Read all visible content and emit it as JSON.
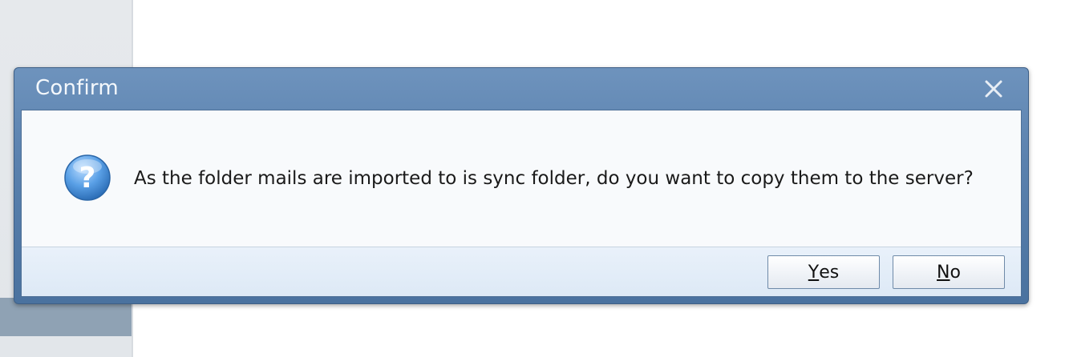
{
  "dialog": {
    "title": "Confirm",
    "message": "As the folder mails are imported to is sync folder, do you want to copy them to the server?",
    "icon": "question-icon",
    "buttons": {
      "yes": {
        "mnemonic": "Y",
        "rest": "es"
      },
      "no": {
        "mnemonic": "N",
        "rest": "o"
      }
    }
  },
  "colors": {
    "titlebar": "#5a81ae",
    "button_strip": "#e3edf8",
    "question_icon": "#4a8fd8"
  }
}
